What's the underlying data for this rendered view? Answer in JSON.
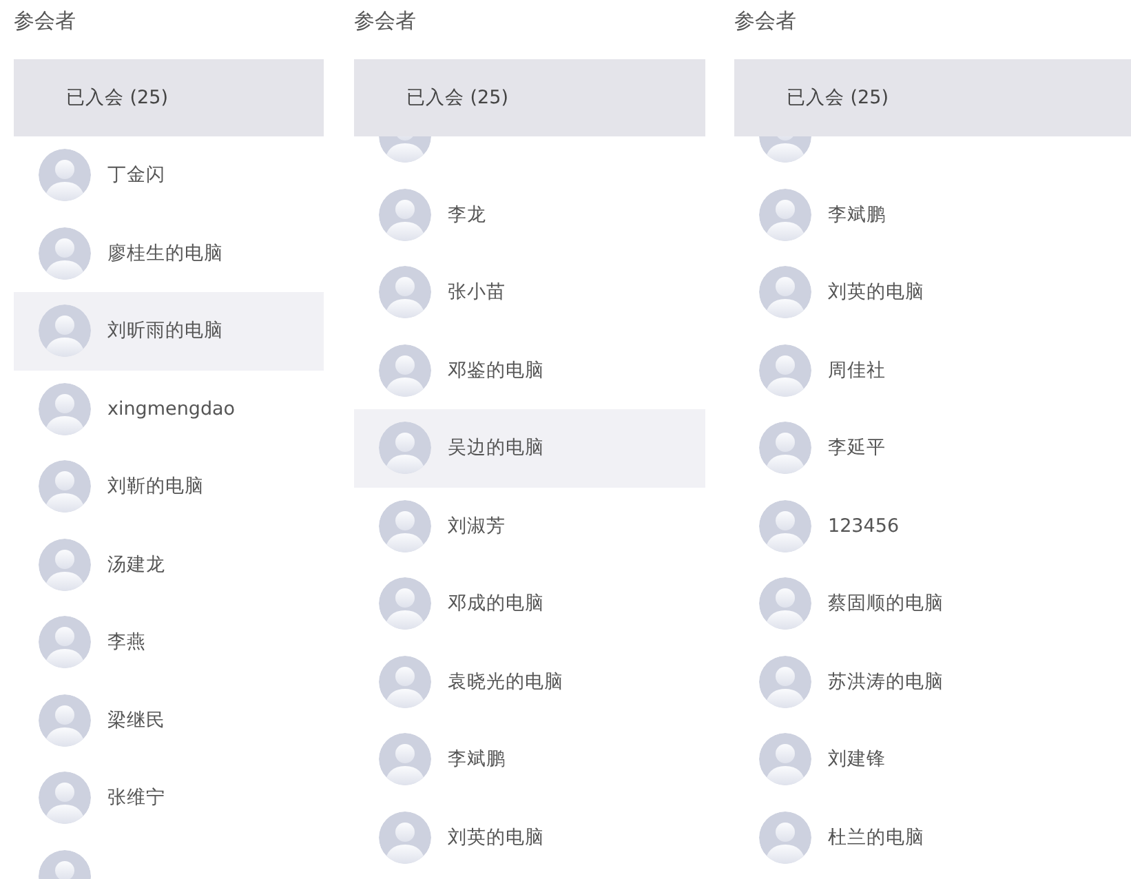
{
  "panels": [
    {
      "title": "参会者",
      "group": "已入会 (25)",
      "rows": [
        {
          "kind": "person",
          "name": "丁金闪",
          "selected": false
        },
        {
          "kind": "person",
          "name": "廖桂生的电脑",
          "selected": false
        },
        {
          "kind": "person",
          "name": "刘昕雨的电脑",
          "selected": true
        },
        {
          "kind": "person",
          "name": "xingmengdao",
          "selected": false
        },
        {
          "kind": "person",
          "name": "刘靳的电脑",
          "selected": false
        },
        {
          "kind": "person",
          "name": "汤建龙",
          "selected": false
        },
        {
          "kind": "person",
          "name": "李燕",
          "selected": false
        },
        {
          "kind": "person",
          "name": "梁继民",
          "selected": false
        },
        {
          "kind": "person",
          "name": "张维宁",
          "selected": false
        },
        {
          "kind": "cut",
          "selected": false
        }
      ]
    },
    {
      "title": "参会者",
      "group": "已入会 (25)",
      "rows": [
        {
          "kind": "cut",
          "selected": false
        },
        {
          "kind": "person",
          "name": "李龙",
          "selected": false
        },
        {
          "kind": "person",
          "name": "张小苗",
          "selected": false
        },
        {
          "kind": "person",
          "name": "邓鉴的电脑",
          "selected": false
        },
        {
          "kind": "person",
          "name": "吴边的电脑",
          "selected": true
        },
        {
          "kind": "person",
          "name": "刘淑芳",
          "selected": false
        },
        {
          "kind": "person",
          "name": "邓成的电脑",
          "selected": false
        },
        {
          "kind": "person",
          "name": "袁晓光的电脑",
          "selected": false
        },
        {
          "kind": "person",
          "name": "李斌鹏",
          "selected": false
        },
        {
          "kind": "person",
          "name": "刘英的电脑",
          "selected": false
        }
      ]
    },
    {
      "title": "参会者",
      "group": "已入会 (25)",
      "rows": [
        {
          "kind": "cut",
          "selected": false
        },
        {
          "kind": "person",
          "name": "李斌鹏",
          "selected": false
        },
        {
          "kind": "person",
          "name": "刘英的电脑",
          "selected": false
        },
        {
          "kind": "person",
          "name": "周佳社",
          "selected": false
        },
        {
          "kind": "person",
          "name": "李延平",
          "selected": false
        },
        {
          "kind": "person",
          "name": "123456",
          "selected": false
        },
        {
          "kind": "person",
          "name": "蔡固顺的电脑",
          "selected": false
        },
        {
          "kind": "person",
          "name": "苏洪涛的电脑",
          "selected": false
        },
        {
          "kind": "person",
          "name": "刘建锋",
          "selected": false
        },
        {
          "kind": "person",
          "name": "杜兰的电脑",
          "selected": false
        }
      ]
    }
  ]
}
